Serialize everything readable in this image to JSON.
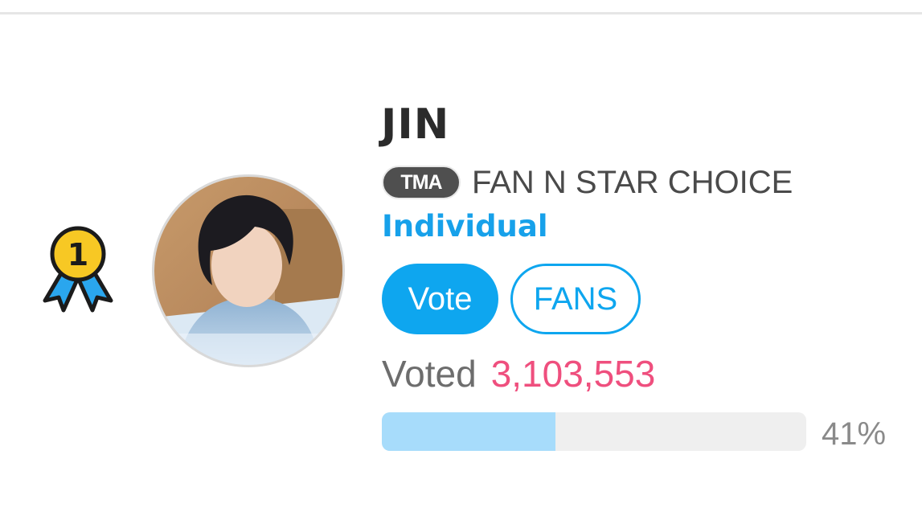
{
  "candidate": {
    "rank": "1",
    "name": "JIN",
    "award_logo": "TMA",
    "award": "FAN N STAR CHOICE",
    "category": "Individual"
  },
  "actions": {
    "vote_label": "Vote",
    "fans_label": "FANS"
  },
  "votes": {
    "label": "Voted",
    "count": "3,103,553",
    "percent_text": "41%",
    "percent": 41
  },
  "icons": {
    "rank": "first-place-ribbon-icon",
    "avatar": "profile-photo"
  },
  "colors": {
    "accent": "#0ea6ef",
    "category": "#17a1ea",
    "vote_count": "#ef4f7e",
    "progress_fill": "#a7dcfb",
    "progress_track": "#efefef",
    "badge_gold": "#f7c824",
    "ribbon_blue": "#2aa6ee"
  }
}
